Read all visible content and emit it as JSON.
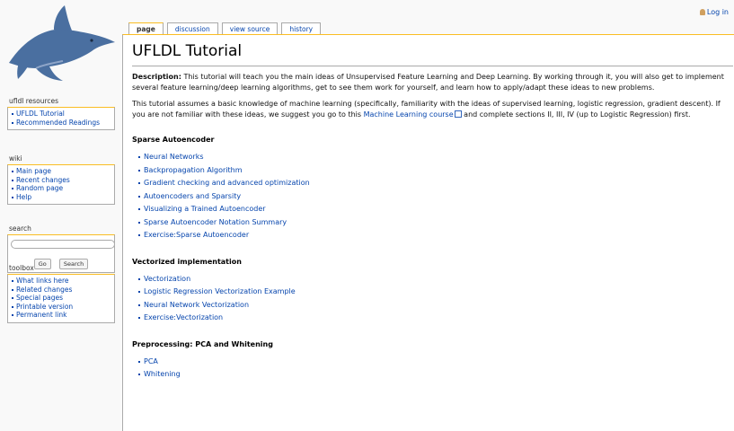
{
  "login": {
    "label": "Log in"
  },
  "tabs": [
    {
      "label": "page"
    },
    {
      "label": "discussion"
    },
    {
      "label": "view source"
    },
    {
      "label": "history"
    }
  ],
  "sidebar": {
    "resources": {
      "title": "ufldl resources",
      "items": [
        "UFLDL Tutorial",
        "Recommended Readings"
      ]
    },
    "wiki": {
      "title": "wiki",
      "items": [
        "Main page",
        "Recent changes",
        "Random page",
        "Help"
      ]
    },
    "search": {
      "title": "search",
      "go_label": "Go",
      "search_label": "Search"
    },
    "toolbox": {
      "title": "toolbox",
      "items": [
        "What links here",
        "Related changes",
        "Special pages",
        "Printable version",
        "Permanent link"
      ]
    }
  },
  "content": {
    "title": "UFLDL Tutorial",
    "description_label": "Description:",
    "description_text": " This tutorial will teach you the main ideas of Unsupervised Feature Learning and Deep Learning. By working through it, you will also get to implement several feature learning/deep learning algorithms, get to see them work for yourself, and learn how to apply/adapt these ideas to new problems.",
    "assume_before": "This tutorial assumes a basic knowledge of machine learning (specifically, familiarity with the ideas of supervised learning, logistic regression, gradient descent). If you are not familiar with these ideas, we suggest you go to this ",
    "assume_link": "Machine Learning course",
    "assume_after": " and complete sections II, III, IV (up to Logistic Regression) first.",
    "sections": [
      {
        "heading": "Sparse Autoencoder",
        "items": [
          "Neural Networks",
          "Backpropagation Algorithm",
          "Gradient checking and advanced optimization",
          "Autoencoders and Sparsity",
          "Visualizing a Trained Autoencoder",
          "Sparse Autoencoder Notation Summary",
          "Exercise:Sparse Autoencoder"
        ]
      },
      {
        "heading": "Vectorized implementation",
        "items": [
          "Vectorization",
          "Logistic Regression Vectorization Example",
          "Neural Network Vectorization",
          "Exercise:Vectorization"
        ]
      },
      {
        "heading": "Preprocessing: PCA and Whitening",
        "items": [
          "PCA",
          "Whitening"
        ]
      }
    ]
  }
}
